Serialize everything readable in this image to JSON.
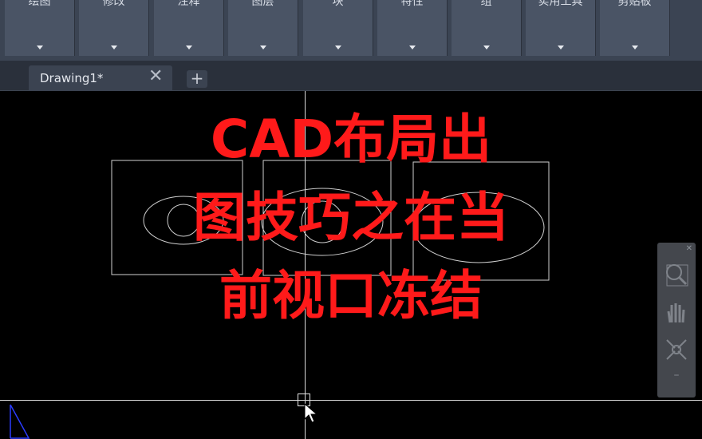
{
  "ribbon": {
    "panels": [
      {
        "label": "绘图"
      },
      {
        "label": "修改"
      },
      {
        "label": "注释"
      },
      {
        "label": "图层"
      },
      {
        "label": "块"
      },
      {
        "label": "特性"
      },
      {
        "label": "组"
      },
      {
        "label": "实用工具"
      },
      {
        "label": "剪贴板"
      }
    ]
  },
  "tabs": {
    "active_label": "Drawing1*",
    "close_glyph": "✕",
    "add_glyph": "+"
  },
  "overlay": {
    "line1": "CAD布局出",
    "line2": "图技巧之在当",
    "line3": "前视口冻结",
    "color": "#ff1a1a"
  },
  "navbar": {
    "items": [
      {
        "icon": "zoom-2d-icon"
      },
      {
        "icon": "pan-hand-icon"
      },
      {
        "icon": "zoom-extents-icon"
      }
    ]
  },
  "colors": {
    "ribbon_bg": "#3b4453",
    "canvas_bg": "#000000",
    "crosshair": "#d9d9d9",
    "drawing_lines": "#cfcfcf",
    "ucs_icon": "#2a3cff"
  }
}
